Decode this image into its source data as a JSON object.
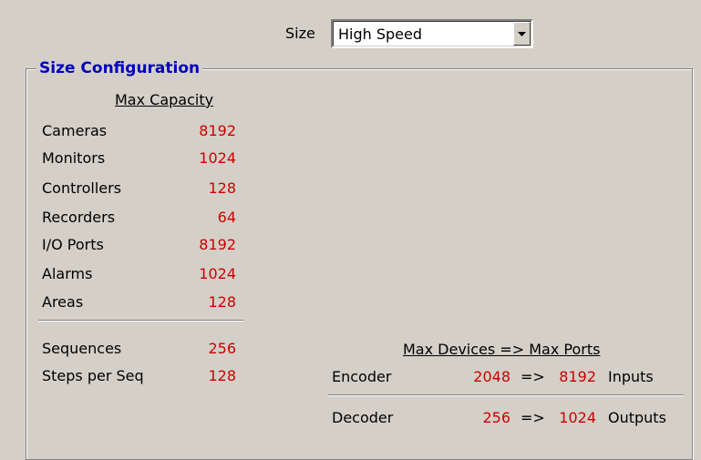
{
  "size": {
    "label": "Size",
    "value": "High Speed"
  },
  "group": {
    "title": "Size Configuration",
    "capacity_header": "Max Capacity",
    "items": [
      {
        "label": "Cameras",
        "value": "8192"
      },
      {
        "label": "Monitors",
        "value": "1024"
      },
      {
        "label": "Controllers",
        "value": "128"
      },
      {
        "label": "Recorders",
        "value": "64"
      },
      {
        "label": "I/O Ports",
        "value": "8192"
      },
      {
        "label": "Alarms",
        "value": "1024"
      },
      {
        "label": "Areas",
        "value": "128"
      }
    ],
    "extra_items": [
      {
        "label": "Sequences",
        "value": "256"
      },
      {
        "label": "Steps per Seq",
        "value": "128"
      }
    ],
    "devices_header": "Max Devices => Max Ports",
    "devices": [
      {
        "name": "Encoder",
        "count": "2048",
        "arrow": "=>",
        "ports": "8192",
        "direction": "Inputs"
      },
      {
        "name": "Decoder",
        "count": "256",
        "arrow": "=>",
        "ports": "1024",
        "direction": "Outputs"
      }
    ]
  },
  "colors": {
    "background": "#d4d0c8",
    "title": "#0000c0",
    "value": "#cc0000"
  }
}
